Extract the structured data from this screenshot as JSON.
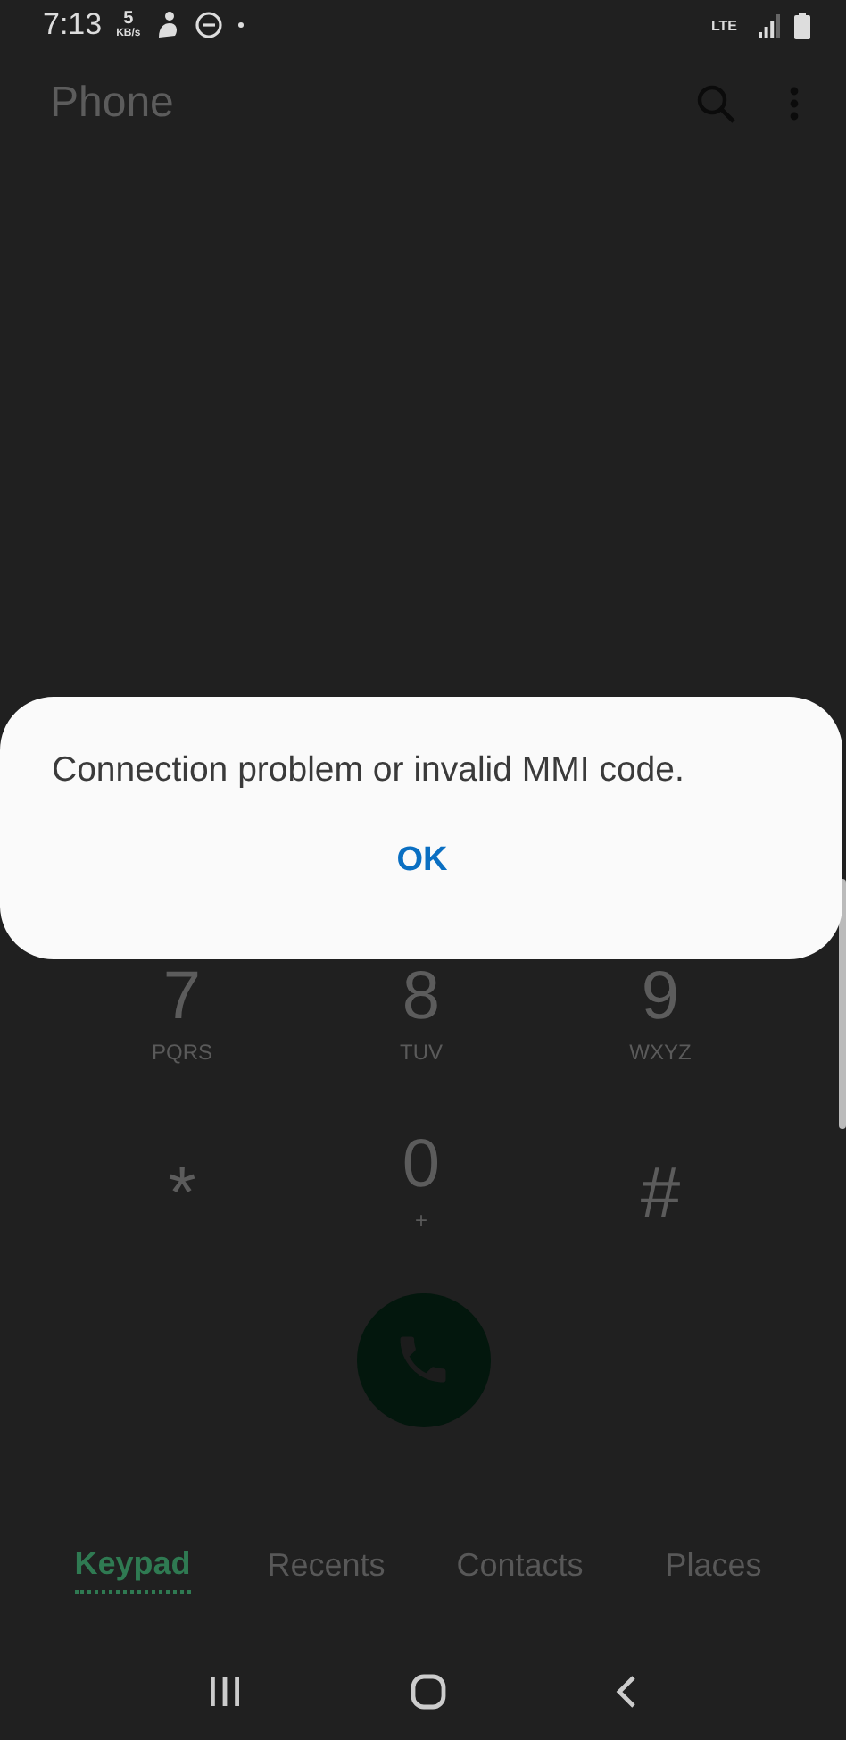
{
  "status_bar": {
    "time": "7:13",
    "speed_value": "5",
    "speed_unit": "KB/s",
    "network": "LTE"
  },
  "app_bar": {
    "title": "Phone"
  },
  "keypad": [
    {
      "digit": "7",
      "letters": "PQRS"
    },
    {
      "digit": "8",
      "letters": "TUV"
    },
    {
      "digit": "9",
      "letters": "WXYZ"
    },
    {
      "digit": "*"
    },
    {
      "digit": "0",
      "letters": "+"
    },
    {
      "digit": "#"
    }
  ],
  "tabs": [
    {
      "label": "Keypad",
      "selected": true
    },
    {
      "label": "Recents",
      "selected": false
    },
    {
      "label": "Contacts",
      "selected": false
    },
    {
      "label": "Places",
      "selected": false
    }
  ],
  "dialog": {
    "message": "Connection problem or invalid MMI code.",
    "button": "OK"
  }
}
